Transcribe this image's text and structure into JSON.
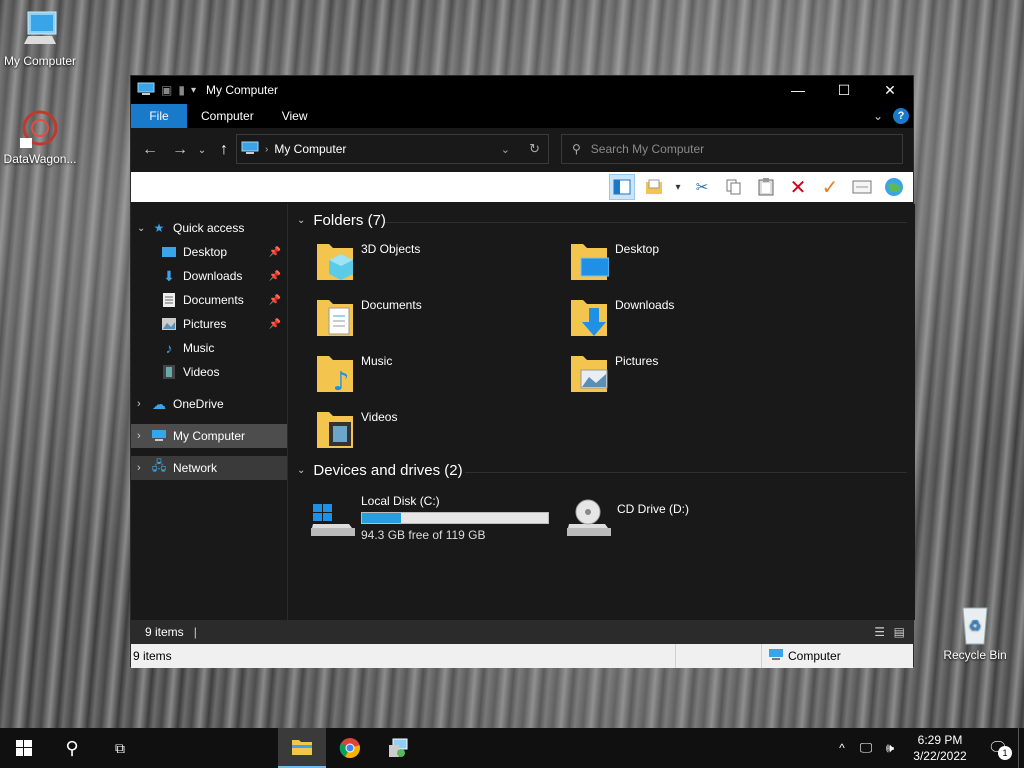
{
  "desktop": {
    "icons": [
      {
        "label": "My Computer"
      },
      {
        "label": "DataWagon..."
      },
      {
        "label": "Recycle Bin"
      }
    ]
  },
  "window": {
    "title": "My Computer",
    "tabs": {
      "file": "File",
      "computer": "Computer",
      "view": "View"
    },
    "address": "My Computer",
    "search_placeholder": "Search My Computer",
    "sidebar": {
      "quick_access": "Quick access",
      "items": [
        {
          "label": "Desktop"
        },
        {
          "label": "Downloads"
        },
        {
          "label": "Documents"
        },
        {
          "label": "Pictures"
        },
        {
          "label": "Music"
        },
        {
          "label": "Videos"
        }
      ],
      "onedrive": "OneDrive",
      "my_computer": "My Computer",
      "network": "Network"
    },
    "folders_header": "Folders (7)",
    "folders": [
      {
        "name": "3D Objects"
      },
      {
        "name": "Desktop"
      },
      {
        "name": "Documents"
      },
      {
        "name": "Downloads"
      },
      {
        "name": "Music"
      },
      {
        "name": "Pictures"
      },
      {
        "name": "Videos"
      }
    ],
    "devices_header": "Devices and drives (2)",
    "drives": [
      {
        "name": "Local Disk (C:)",
        "free": "94.3 GB free of 119 GB",
        "used_percent": 21
      },
      {
        "name": "CD Drive (D:)"
      }
    ],
    "status_items": "9 items",
    "status_bottom_items": "9 items",
    "status_bottom_location": "Computer"
  },
  "taskbar": {
    "time": "6:29 PM",
    "date": "3/22/2022",
    "notification_count": "1"
  },
  "colors": {
    "accent": "#1979ca",
    "drive_bar": "#26a0da",
    "folder": "#f3c54e"
  }
}
